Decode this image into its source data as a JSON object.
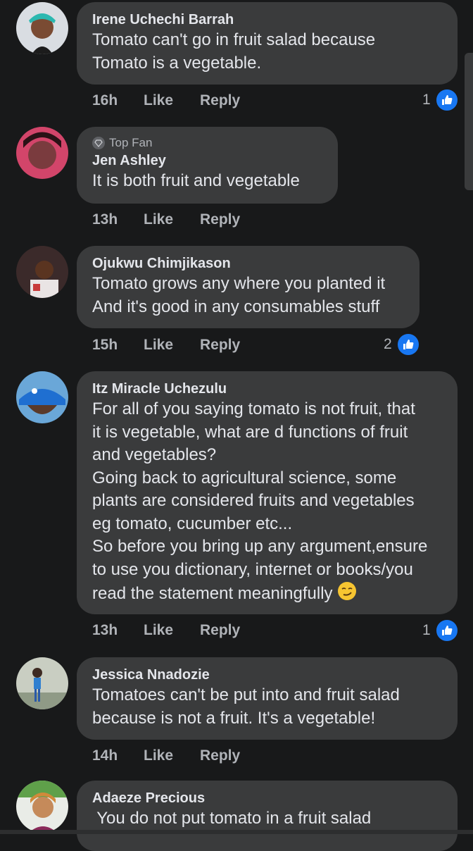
{
  "comments": [
    {
      "author": "Irene Uchechi Barrah",
      "text": "Tomato can't go in fruit salad because\nTomato is a vegetable.",
      "time": "16h",
      "like_label": "Like",
      "reply_label": "Reply",
      "reaction_count": "1"
    },
    {
      "badge": "Top Fan",
      "author": "Jen Ashley",
      "text": "It is both fruit and vegetable",
      "time": "13h",
      "like_label": "Like",
      "reply_label": "Reply"
    },
    {
      "author": "Ojukwu Chimjikason",
      "text": "Tomato grows any where you planted it\nAnd it's good in any consumables stuff",
      "time": "15h",
      "like_label": "Like",
      "reply_label": "Reply",
      "reaction_count": "2"
    },
    {
      "author": "Itz Miracle Uchezulu",
      "text": "For all of you saying tomato is not fruit, that\nit is vegetable, what are d functions of fruit\nand vegetables?\nGoing back to agricultural science, some\nplants are considered fruits and vegetables\neg tomato, cucumber etc...\nSo before you bring up any argument,ensure\nto use you dictionary,  internet or books/you\nread the statement meaningfully",
      "emoji": "smirking-face-emoji",
      "time": "13h",
      "like_label": "Like",
      "reply_label": "Reply",
      "reaction_count": "1"
    },
    {
      "author": "Jessica Nnadozie",
      "text": "Tomatoes can't be put into and fruit salad\nbecause is not a fruit. It's a vegetable!",
      "time": "14h",
      "like_label": "Like",
      "reply_label": "Reply"
    },
    {
      "author": "Adaeze Precious",
      "text": " You do not put tomato in a fruit salad"
    }
  ],
  "colors": {
    "background": "#18191a",
    "bubble": "#3a3b3c",
    "primary_text": "#e4e6eb",
    "secondary_text": "#b0b3b8",
    "like_blue": "#1877f2"
  }
}
